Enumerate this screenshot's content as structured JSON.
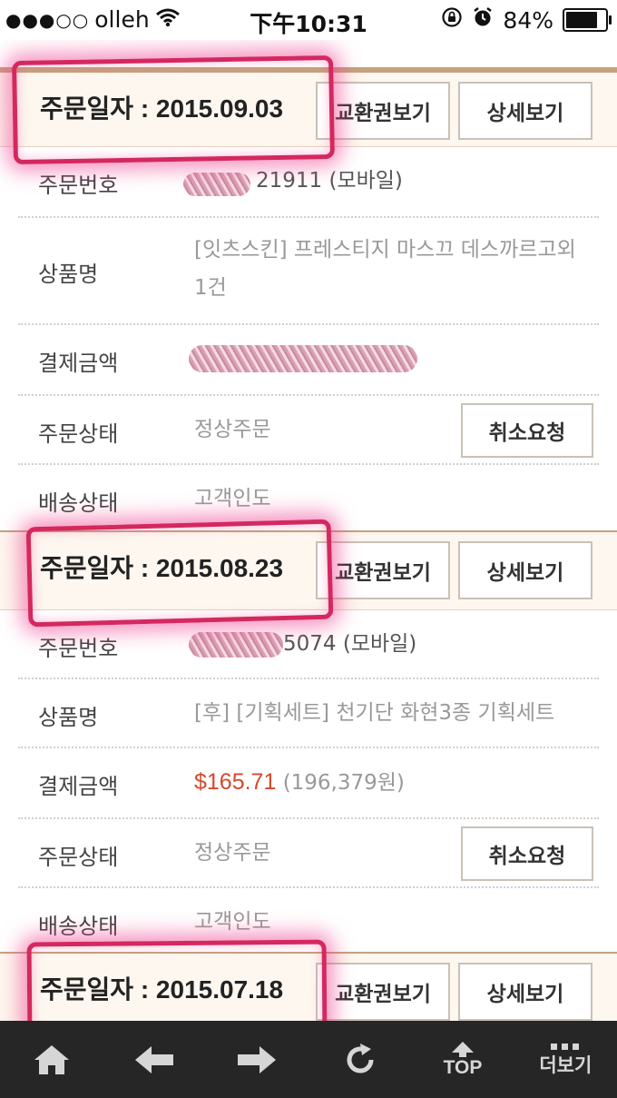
{
  "status_bar": {
    "signal": "●●●○○",
    "carrier": "olleh",
    "time": "下午10:31",
    "battery": "84%",
    "battery_level": 0.84,
    "icons": [
      "wifi-icon",
      "rotation-lock-icon",
      "alarm-icon",
      "battery-icon"
    ]
  },
  "labels": {
    "order_no": "주문번호",
    "product": "상품명",
    "payment": "결제금액",
    "order_status": "주문상태",
    "shipping_status": "배송상태",
    "exchange_button": "교환권보기",
    "detail_button": "상세보기",
    "cancel_button": "취소요청"
  },
  "orders": [
    {
      "date": "주문일자 : 2015.09.03",
      "order_no": "21911 (모바일)",
      "product": "[잇츠스킨] 프레스티지 마스끄 데스까르고외 1건",
      "payment": "",
      "order_status": "정상주문",
      "shipping_status": "고객인도"
    },
    {
      "date": "주문일자 : 2015.08.23",
      "order_no": "5074 (모바일)",
      "product": "[후] [기획세트] 천기단 화현3종 기획세트",
      "payment_usd": "$165.71",
      "payment_krw": "(196,379원)",
      "order_status": "정상주문",
      "shipping_status": "고객인도"
    },
    {
      "date": "주문일자 : 2015.07.18"
    }
  ],
  "toolbar": {
    "items": [
      {
        "name": "home-icon"
      },
      {
        "name": "back-arrow-icon"
      },
      {
        "name": "forward-arrow-icon"
      },
      {
        "name": "refresh-icon"
      },
      {
        "name": "top-icon",
        "label": "TOP"
      },
      {
        "name": "more-icon",
        "label": "더보기"
      }
    ]
  },
  "colors": {
    "header_bg": "#fdf7ef",
    "header_border": "#c7a17e",
    "price": "#d9482b",
    "highlight": "#d4285f",
    "toolbar_bg": "#262626"
  }
}
